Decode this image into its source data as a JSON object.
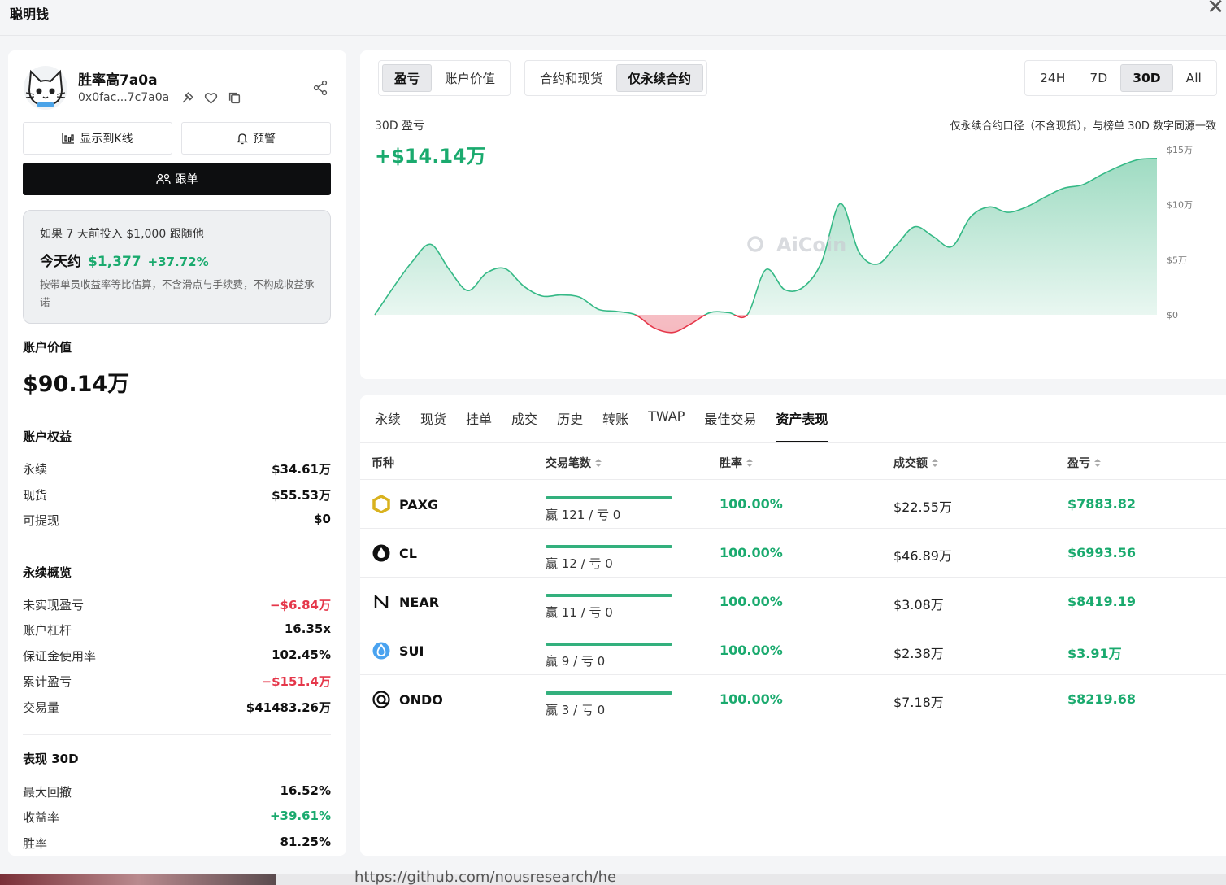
{
  "window": {
    "title": "聪明钱",
    "close": "✕"
  },
  "profile": {
    "name": "胜率高7a0a",
    "address": "0x0fac...7c7a0a",
    "show_kline_label": "显示到K线",
    "alert_label": "预警",
    "follow_label": "跟单"
  },
  "simulation": {
    "line1": "如果 7 天前投入 $1,000 跟随他",
    "today_label": "今天约",
    "today_value": "$1,377",
    "today_pct": "+37.72%",
    "note": "按带单员收益率等比估算，不含滑点与手续费，不构成收益承诺"
  },
  "account_value": {
    "label": "账户价值",
    "value": "$90.14万"
  },
  "equity": {
    "label": "账户权益",
    "items": [
      {
        "k": "永续",
        "v": "$34.61万"
      },
      {
        "k": "现货",
        "v": "$55.53万"
      },
      {
        "k": "可提现",
        "v": "$0"
      }
    ]
  },
  "perp": {
    "label": "永续概览",
    "items": [
      {
        "k": "未实现盈亏",
        "v": "−$6.84万"
      },
      {
        "k": "账户杠杆",
        "v": "16.35x"
      },
      {
        "k": "保证金使用率",
        "v": "102.45%"
      },
      {
        "k": "累计盈亏",
        "v": "−$151.4万"
      },
      {
        "k": "交易量",
        "v": "$41483.26万"
      }
    ]
  },
  "perf": {
    "label": "表现 30D",
    "items": [
      {
        "k": "最大回撤",
        "v": "16.52%"
      },
      {
        "k": "收益率",
        "v": "+39.61%"
      },
      {
        "k": "胜率",
        "v": "81.25%"
      }
    ]
  },
  "chart_controls": {
    "metric": [
      "盈亏",
      "账户价值"
    ],
    "scope": [
      "合约和现货",
      "仅永续合约"
    ],
    "range": [
      "24H",
      "7D",
      "30D",
      "All"
    ]
  },
  "chart_data": {
    "type": "area",
    "title": "30D 盈亏",
    "value": "+$14.14万",
    "note": "仅永续合约口径（不含现货），与榜单 30D 数字同源一致",
    "watermark": "AiCoin",
    "y_unit": "万",
    "ylim": [
      -1.8,
      15
    ],
    "y_ticks": [
      "$0",
      "$5万",
      "$10万",
      "$15万"
    ],
    "y": [
      0,
      2.5,
      4.8,
      6.4,
      4.1,
      2.2,
      3.8,
      4.2,
      2.6,
      1.7,
      1.8,
      1.6,
      0.5,
      0.3,
      0,
      -1.2,
      -1.6,
      -0.8,
      0.2,
      0.2,
      0,
      4.1,
      2.3,
      2.5,
      4.8,
      10.1,
      5.7,
      4.6,
      6.3,
      8.0,
      7.1,
      6.2,
      8.9,
      9.8,
      9.3,
      9.8,
      10.7,
      11.5,
      11.8,
      12.7,
      13.5,
      14.1,
      14.2
    ]
  },
  "table": {
    "tabs": [
      "永续",
      "现货",
      "挂单",
      "成交",
      "历史",
      "转账",
      "TWAP",
      "最佳交易",
      "资产表现"
    ],
    "headers": [
      "币种",
      "交易笔数",
      "胜率",
      "成交额",
      "盈亏"
    ],
    "rows": [
      {
        "coin": "PAXG",
        "trades": "赢 121 / 亏 0",
        "win_rate": "100.00%",
        "volume": "$22.55万",
        "pnl": "$7883.82"
      },
      {
        "coin": "CL",
        "trades": "赢 12 / 亏 0",
        "win_rate": "100.00%",
        "volume": "$46.89万",
        "pnl": "$6993.56"
      },
      {
        "coin": "NEAR",
        "trades": "赢 11 / 亏 0",
        "win_rate": "100.00%",
        "volume": "$3.08万",
        "pnl": "$8419.19"
      },
      {
        "coin": "SUI",
        "trades": "赢 9 / 亏 0",
        "win_rate": "100.00%",
        "volume": "$2.38万",
        "pnl": "$3.91万"
      },
      {
        "coin": "ONDO",
        "trades": "赢 3 / 亏 0",
        "win_rate": "100.00%",
        "volume": "$7.18万",
        "pnl": "$8219.68"
      }
    ]
  },
  "taskbar": {
    "url": "https://github.com/nousresearch/he"
  },
  "colors": {
    "green": "#1aaa6e",
    "red": "#e5374a",
    "dark": "#0d0e10"
  }
}
